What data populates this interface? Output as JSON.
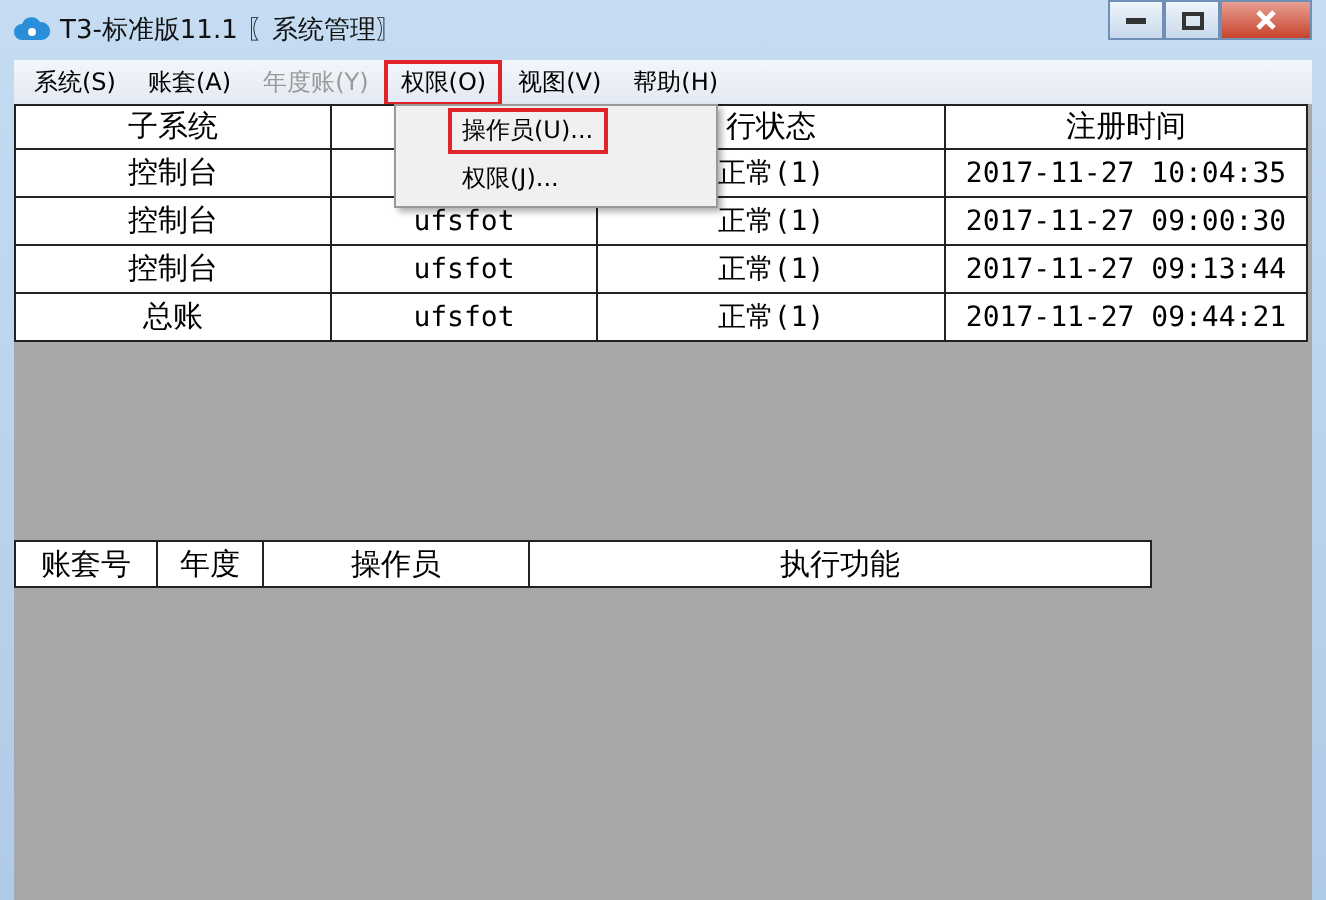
{
  "window": {
    "title": "T3-标准版11.1 〖系统管理〗"
  },
  "menu": [
    {
      "label": "系统(S)",
      "disabled": false,
      "highlighted": false
    },
    {
      "label": "账套(A)",
      "disabled": false,
      "highlighted": false
    },
    {
      "label": "年度账(Y)",
      "disabled": true,
      "highlighted": false
    },
    {
      "label": "权限(O)",
      "disabled": false,
      "highlighted": true
    },
    {
      "label": "视图(V)",
      "disabled": false,
      "highlighted": false
    },
    {
      "label": "帮助(H)",
      "disabled": false,
      "highlighted": false
    }
  ],
  "dropdown": {
    "items": [
      {
        "label": "操作员(U)...",
        "highlighted": true
      },
      {
        "label": "权限(J)...",
        "highlighted": false
      }
    ]
  },
  "upper_table": {
    "columns": {
      "subsystem": "子系统",
      "status": "行状态",
      "time": "注册时间"
    },
    "rows": [
      {
        "subsystem": "控制台",
        "status": "正常(1)",
        "time": "2017-11-27 10:04:35"
      },
      {
        "subsystem": "控制台",
        "column_2": "ufsfot",
        "status": "正常(1)",
        "time": "2017-11-27 09:00:30"
      },
      {
        "subsystem": "控制台",
        "column_2": "ufsfot",
        "status": "正常(1)",
        "time": "2017-11-27 09:13:44"
      },
      {
        "subsystem": "总账",
        "column_2": "ufsfot",
        "status": "正常(1)",
        "time": "2017-11-27 09:44:21"
      }
    ]
  },
  "lower_table": {
    "columns": [
      "账套号",
      "年度",
      "操作员",
      "执行功能"
    ]
  }
}
